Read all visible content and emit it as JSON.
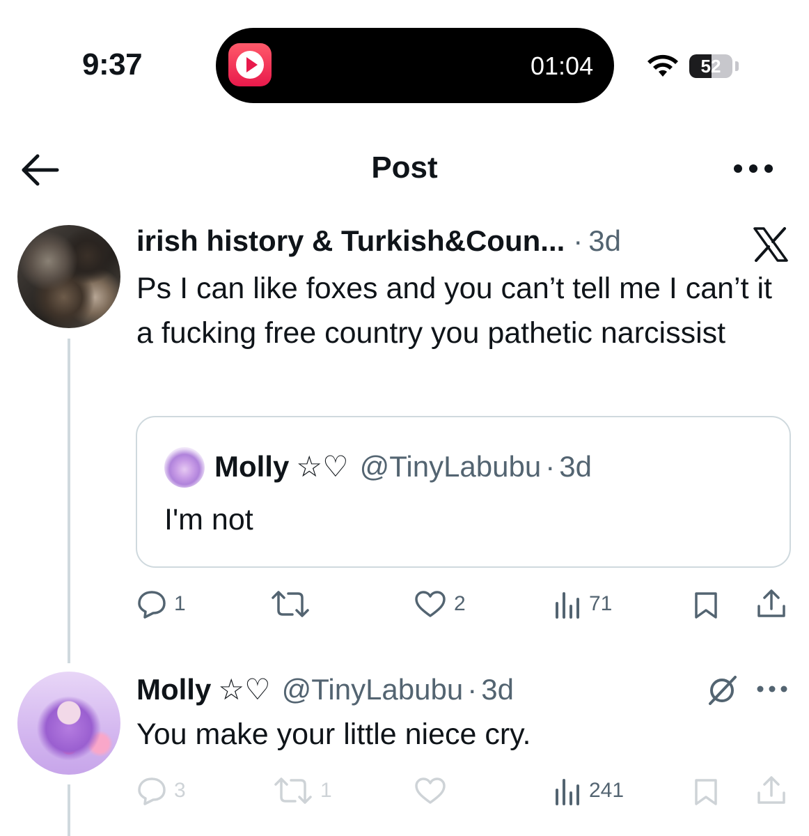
{
  "status_bar": {
    "time": "9:37",
    "activity_timer": "01:04",
    "battery_level": "52",
    "battery_fraction": 0.52
  },
  "header": {
    "title": "Post"
  },
  "main_post": {
    "author_name": "irish history & Turkish&Coun...",
    "separator": "·",
    "time_ago": "3d",
    "text": "Ps I can like foxes and you can’t tell me I can’t it a fucking free country you pathetic narcissist",
    "quote": {
      "author_name": "Molly",
      "name_symbols": "☆♡",
      "handle": "@TinyLabubu",
      "separator": "·",
      "time_ago": "3d",
      "text": "I'm not"
    },
    "actions": {
      "replies": "1",
      "reposts": "",
      "likes": "2",
      "views": "71"
    }
  },
  "reply_post": {
    "author_name": "Molly",
    "name_symbols": "☆♡",
    "handle": "@TinyLabubu",
    "separator": "·",
    "time_ago": "3d",
    "text": "You make your little niece cry.",
    "actions": {
      "replies": "3",
      "reposts": "1",
      "likes": "",
      "views": "241"
    }
  },
  "colors": {
    "text": "#0f1419",
    "secondary": "#536471",
    "border": "#cfd9de",
    "thread_line": "#cfd9de"
  },
  "icons": [
    "back-arrow-icon",
    "more-icon",
    "x-logo-icon",
    "reply-icon",
    "repost-icon",
    "like-icon",
    "views-icon",
    "bookmark-icon",
    "share-icon",
    "grok-icon",
    "wifi-icon",
    "battery-icon"
  ]
}
